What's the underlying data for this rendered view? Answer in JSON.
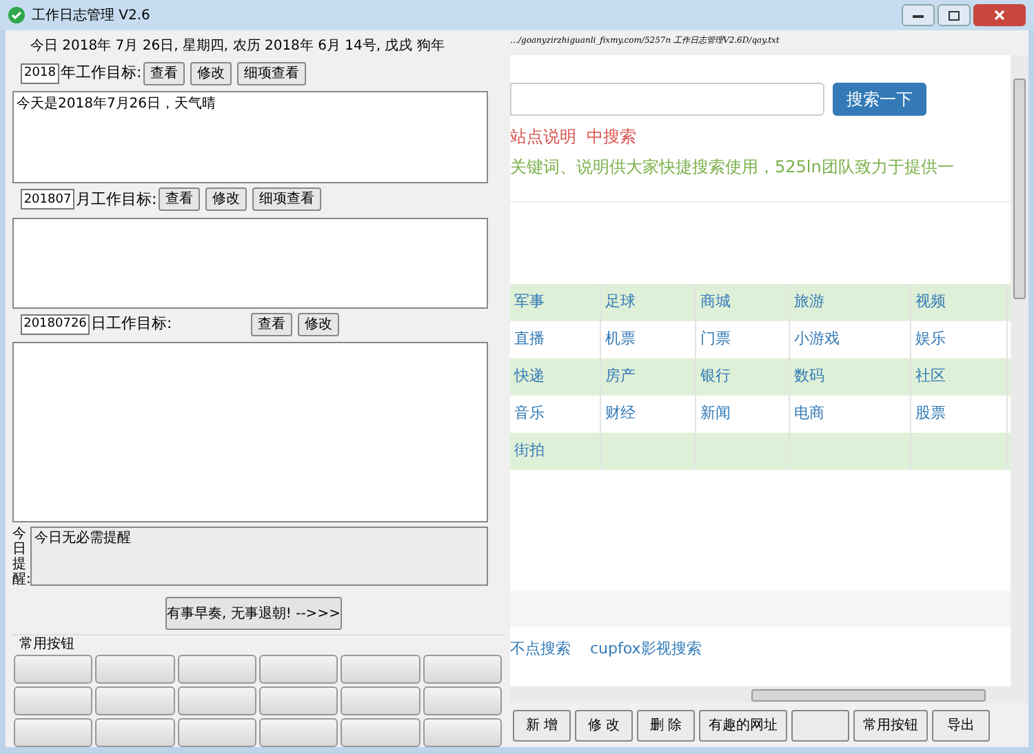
{
  "window": {
    "title": "工作日志管理 V2.6"
  },
  "today": "今日 2018年 7月 26日, 星期四, 农历 2018年 6月 14号, 戊戌 狗年",
  "goals": [
    {
      "period": "2018",
      "label": "年工作目标:",
      "buttons": [
        "查看",
        "修改",
        "细项查看"
      ],
      "text": "今天是2018年7月26日，天气晴"
    },
    {
      "period": "201807",
      "label": "月工作目标:",
      "buttons": [
        "查看",
        "修改",
        "细项查看"
      ]
    },
    {
      "period": "20180726",
      "label": "日工作目标:",
      "buttons": [
        "查看",
        "修改"
      ]
    }
  ],
  "reminder": {
    "label": "今日提醒:",
    "text": "今日无必需提醒"
  },
  "court_button": "有事早奏, 无事退朝! -->>>",
  "common_buttons": {
    "title": "常用按钮",
    "buttons": [
      {
        "kind": "blank"
      },
      {
        "kind": "blank"
      },
      {
        "kind": "blank"
      },
      {
        "kind": "blank"
      },
      {
        "kind": "blank"
      },
      {
        "kind": "blank"
      },
      {
        "kind": "blank"
      },
      {
        "kind": "blank"
      },
      {
        "kind": "blank"
      },
      {
        "kind": "blank"
      },
      {
        "kind": "blank"
      },
      {
        "kind": "blank"
      },
      {
        "kind": "blank"
      },
      {
        "kind": "blank"
      },
      {
        "kind": "blank"
      },
      {
        "kind": "blank"
      },
      {
        "kind": "blank"
      },
      {
        "kind": "blank"
      }
    ]
  },
  "browser": {
    "address": "…/goanyzirzhiguanli_fixmy.com/5257n 工作日志管理V2.6D/qay.txt",
    "search_button": "搜索一下",
    "heading": "站点说明  中搜索",
    "description": "关键词、说明供大家快捷搜索使用，525ln团队致力于提供一",
    "table": {
      "rows": [
        [
          "军事",
          "足球",
          "商城",
          "旅游",
          "视频"
        ],
        [
          "直播",
          "机票",
          "门票",
          "小游戏",
          "娱乐"
        ],
        [
          "快递",
          "房产",
          "银行",
          "数码",
          "社区"
        ],
        [
          "音乐",
          "财经",
          "新闻",
          "电商",
          "股票"
        ],
        [
          "街拍"
        ]
      ]
    },
    "links": [
      "不点搜索",
      "cupfox影视搜索"
    ]
  },
  "toolbar": [
    {
      "kind": "labeled",
      "label": "新 增"
    },
    {
      "kind": "labeled",
      "label": "修 改"
    },
    {
      "kind": "labeled",
      "label": "删 除"
    },
    {
      "kind": "labeled",
      "label": "有趣的网址"
    },
    {
      "kind": "blank"
    },
    {
      "kind": "labeled",
      "label": "常用按钮"
    },
    {
      "kind": "labeled",
      "label": "导出"
    }
  ]
}
